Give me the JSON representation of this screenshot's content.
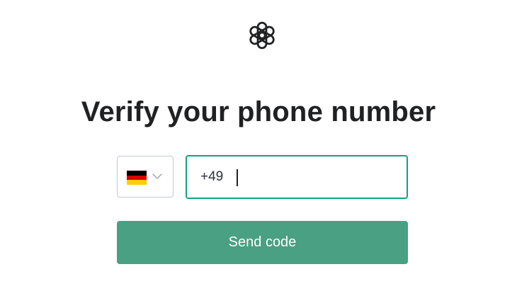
{
  "header": {
    "logo_icon": "openai-logo-icon"
  },
  "main": {
    "title": "Verify your phone number",
    "country_select": {
      "flag_icon": "germany-flag-icon",
      "flag_colors": [
        "#000000",
        "#dd0000",
        "#ffce00"
      ],
      "chevron_icon": "chevron-down-icon"
    },
    "phone_input": {
      "value": "+49 ",
      "border_color": "#10a37f"
    },
    "send_button": {
      "label": "Send code",
      "background_color": "#4aa082"
    }
  }
}
